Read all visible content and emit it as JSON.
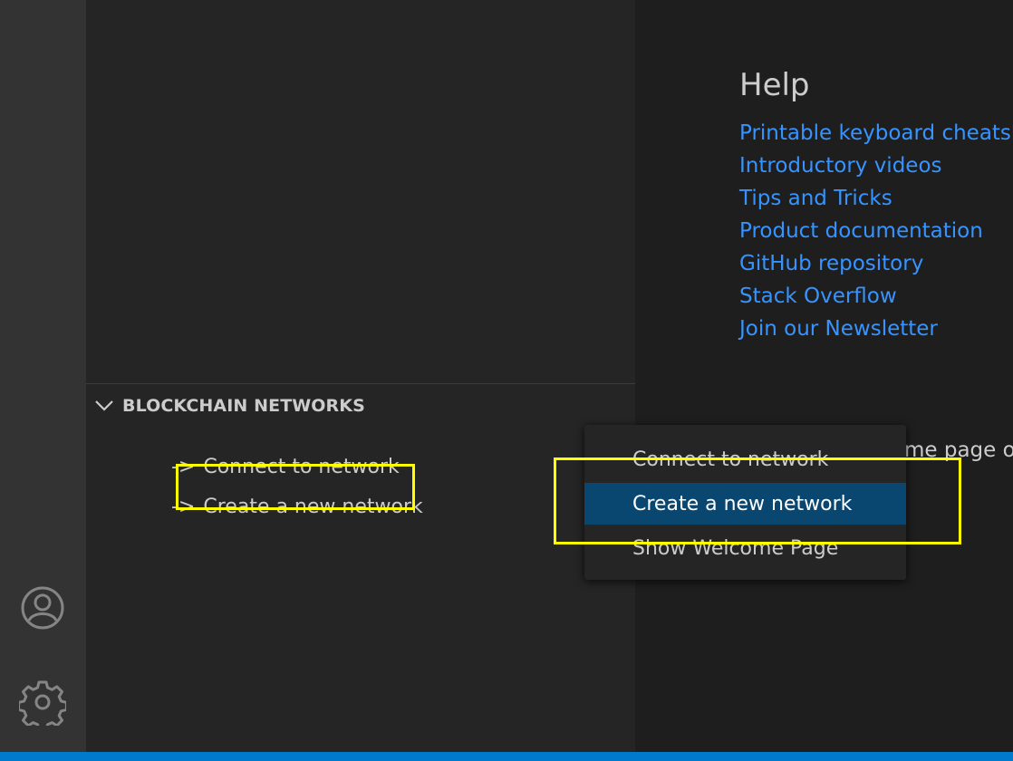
{
  "activity_bar": {
    "accounts_icon": "account-icon",
    "manage_icon": "gear-icon"
  },
  "sidebar": {
    "section": {
      "title": "BLOCKCHAIN NETWORKS",
      "items": [
        {
          "arrow": "->",
          "label": "Connect to network"
        },
        {
          "arrow": "->",
          "label": "Create a new network"
        }
      ]
    }
  },
  "editor": {
    "help": {
      "title": "Help",
      "links": [
        "Printable keyboard cheatsh",
        "Introductory videos",
        "Tips and Tricks",
        "Product documentation",
        "GitHub repository",
        "Stack Overflow",
        "Join our Newsletter"
      ]
    },
    "partial_text": "me page o"
  },
  "context_menu": {
    "items": [
      "Connect to network",
      "Create a new network",
      "Show Welcome Page"
    ],
    "selected": "Create a new network"
  },
  "colors": {
    "highlight": "#ffff00",
    "link": "#3794ff",
    "menu_selected": "#094771",
    "statusbar": "#007acc"
  }
}
